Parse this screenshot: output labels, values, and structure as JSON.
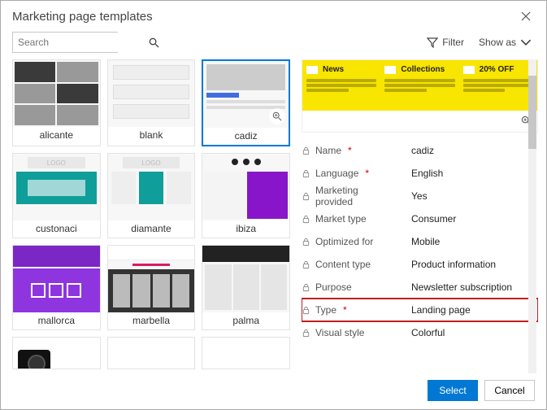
{
  "dialog": {
    "title": "Marketing page templates"
  },
  "search": {
    "placeholder": "Search"
  },
  "toolbar": {
    "filter": "Filter",
    "show_as": "Show as"
  },
  "templates": [
    {
      "name": "alicante"
    },
    {
      "name": "blank"
    },
    {
      "name": "cadiz"
    },
    {
      "name": "custonaci"
    },
    {
      "name": "diamante"
    },
    {
      "name": "ibiza"
    },
    {
      "name": "mallorca"
    },
    {
      "name": "marbella"
    },
    {
      "name": "palma"
    }
  ],
  "selected_template": "cadiz",
  "preview": {
    "cols": [
      {
        "label": "News"
      },
      {
        "label": "Collections"
      },
      {
        "label": "20% OFF"
      }
    ]
  },
  "properties": [
    {
      "label": "Name",
      "required": true,
      "value": "cadiz"
    },
    {
      "label": "Language",
      "required": true,
      "value": "English"
    },
    {
      "label": "Marketing provided",
      "required": false,
      "value": "Yes"
    },
    {
      "label": "Market type",
      "required": false,
      "value": "Consumer"
    },
    {
      "label": "Optimized for",
      "required": false,
      "value": "Mobile"
    },
    {
      "label": "Content type",
      "required": false,
      "value": "Product information"
    },
    {
      "label": "Purpose",
      "required": false,
      "value": "Newsletter subscription"
    },
    {
      "label": "Type",
      "required": true,
      "value": "Landing page",
      "highlight": true
    },
    {
      "label": "Visual style",
      "required": false,
      "value": "Colorful"
    }
  ],
  "footer": {
    "select": "Select",
    "cancel": "Cancel"
  }
}
